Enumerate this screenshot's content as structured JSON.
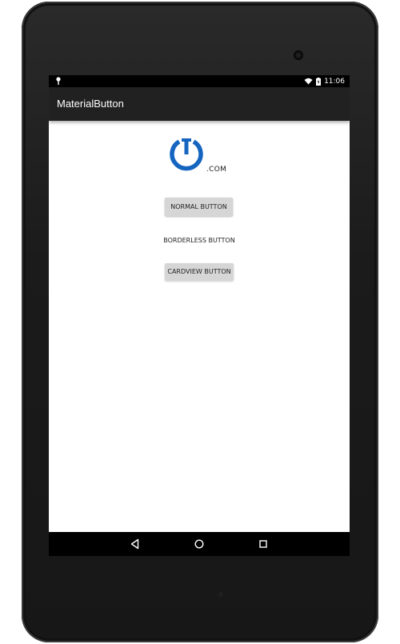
{
  "status_bar": {
    "time": "11:06",
    "left_icon": "notification-pin-icon",
    "icons": [
      "wifi-icon",
      "battery-icon"
    ]
  },
  "app_bar": {
    "title": "MaterialButton"
  },
  "logo": {
    "text": ".COM",
    "icon": "power-t-logo-icon",
    "color": "#1565c0"
  },
  "buttons": {
    "normal": "NORMAL BUTTON",
    "borderless": "BORDERLESS BUTTON",
    "cardview": "CARDVIEW BUTTON"
  },
  "nav_bar": {
    "icons": [
      "back-icon",
      "home-icon",
      "recents-icon"
    ]
  },
  "colors": {
    "app_bar": "#212121",
    "button_bg": "#d6d6d6",
    "status_bar": "#000000"
  }
}
